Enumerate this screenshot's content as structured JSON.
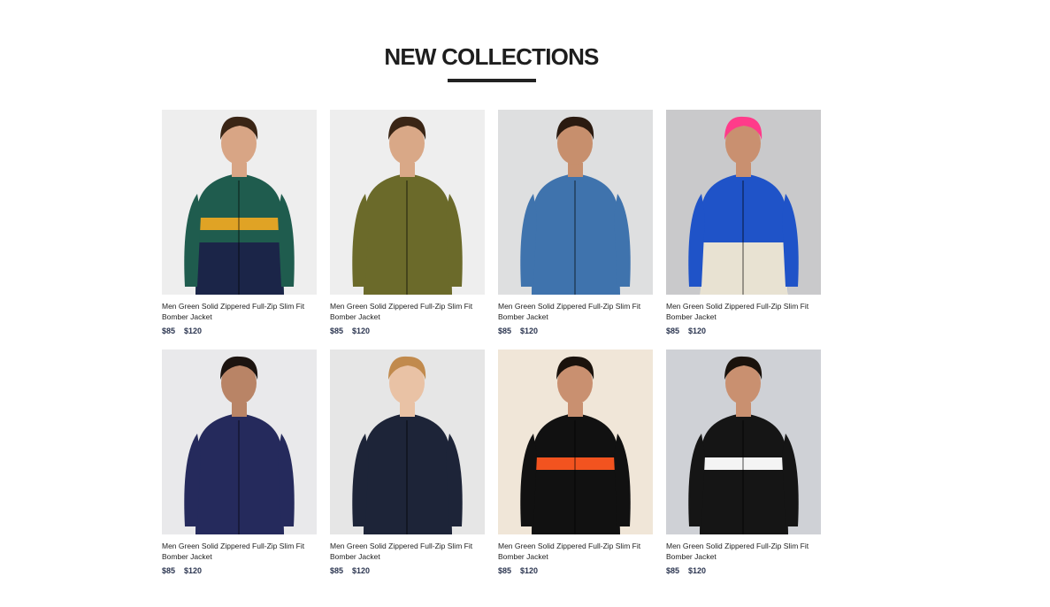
{
  "section": {
    "title": "NEW COLLECTIONS"
  },
  "products": [
    {
      "name": "Men Green Solid Zippered Full-Zip Slim Fit Bomber Jacket",
      "price": "$85",
      "old_price": "$120",
      "colors": {
        "bg": "#eeeeee",
        "top": "#1f5c4e",
        "stripe": "#e0a325",
        "bottom": "#1b2548",
        "skin": "#d8a585",
        "hair": "#3a2515"
      }
    },
    {
      "name": "Men Green Solid Zippered Full-Zip Slim Fit Bomber Jacket",
      "price": "$85",
      "old_price": "$120",
      "colors": {
        "bg": "#eeeeee",
        "top": "#6b6a2a",
        "stripe": "#6b6a2a",
        "bottom": "#6b6a2a",
        "skin": "#d9a887",
        "hair": "#3a2515"
      }
    },
    {
      "name": "Men Green Solid Zippered Full-Zip Slim Fit Bomber Jacket",
      "price": "$85",
      "old_price": "$120",
      "colors": {
        "bg": "#dedfe0",
        "top": "#3f73ad",
        "stripe": "#3f73ad",
        "bottom": "#3f73ad",
        "skin": "#c78f6d",
        "hair": "#2a1a10"
      }
    },
    {
      "name": "Men Green Solid Zippered Full-Zip Slim Fit Bomber Jacket",
      "price": "$85",
      "old_price": "$120",
      "colors": {
        "bg": "#c9c9cb",
        "top": "#1f53c8",
        "stripe": "#1f53c8",
        "bottom": "#e8e2d2",
        "skin": "#c99070",
        "hair": "#ff3b8a"
      }
    },
    {
      "name": "Men Green Solid Zippered Full-Zip Slim Fit Bomber Jacket",
      "price": "$85",
      "old_price": "$120",
      "colors": {
        "bg": "#e9e9eb",
        "top": "#252a5c",
        "stripe": "#252a5c",
        "bottom": "#252a5c",
        "skin": "#b98466",
        "hair": "#1c1410"
      }
    },
    {
      "name": "Men Green Solid Zippered Full-Zip Slim Fit Bomber Jacket",
      "price": "$85",
      "old_price": "$120",
      "colors": {
        "bg": "#e6e6e6",
        "top": "#1d2438",
        "stripe": "#1d2438",
        "bottom": "#1d2438",
        "skin": "#e9c2a5",
        "hair": "#c18a4d"
      }
    },
    {
      "name": "Men Green Solid Zippered Full-Zip Slim Fit Bomber Jacket",
      "price": "$85",
      "old_price": "$120",
      "colors": {
        "bg": "#f0e6d8",
        "top": "#111111",
        "stripe": "#f2531f",
        "bottom": "#111111",
        "skin": "#c99070",
        "hair": "#1a120c"
      }
    },
    {
      "name": "Men Green Solid Zippered Full-Zip Slim Fit Bomber Jacket",
      "price": "$85",
      "old_price": "$120",
      "colors": {
        "bg": "#cfd1d6",
        "top": "#151515",
        "stripe": "#f4f4f4",
        "bottom": "#151515",
        "skin": "#c99070",
        "hair": "#1a120c"
      }
    }
  ]
}
